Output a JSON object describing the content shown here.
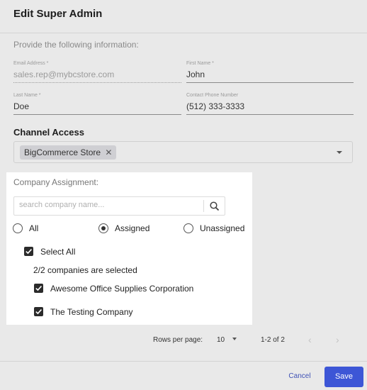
{
  "dialog": {
    "title": "Edit Super Admin",
    "instructions": "Provide the following information:"
  },
  "form": {
    "email": {
      "label": "Email Address *",
      "value": "sales.rep@mybcstore.com"
    },
    "first_name": {
      "label": "First Name *",
      "value": "John"
    },
    "last_name": {
      "label": "Last Name *",
      "value": "Doe"
    },
    "phone": {
      "label": "Contact Phone Number",
      "value": "(512) 333-3333"
    }
  },
  "channel_access": {
    "heading": "Channel Access",
    "chip": "BigCommerce Store",
    "chip_remove": "✕"
  },
  "company": {
    "label": "Company Assignment:",
    "search_placeholder": "search company name...",
    "filters": {
      "all": "All",
      "assigned": "Assigned",
      "unassigned": "Unassigned",
      "selected": "assigned"
    },
    "select_all": "Select All",
    "count_text": "2/2 companies are selected",
    "items": [
      {
        "name": "Awesome Office Supplies Corporation",
        "checked": true
      },
      {
        "name": "The Testing Company",
        "checked": true
      }
    ]
  },
  "pagination": {
    "rows_label": "Rows per page:",
    "rows_value": "10",
    "range": "1-2 of 2",
    "prev": "‹",
    "next": "›"
  },
  "footer": {
    "cancel": "Cancel",
    "save": "Save"
  },
  "colors": {
    "primary": "#3d56d6",
    "link": "#3f51b5"
  }
}
